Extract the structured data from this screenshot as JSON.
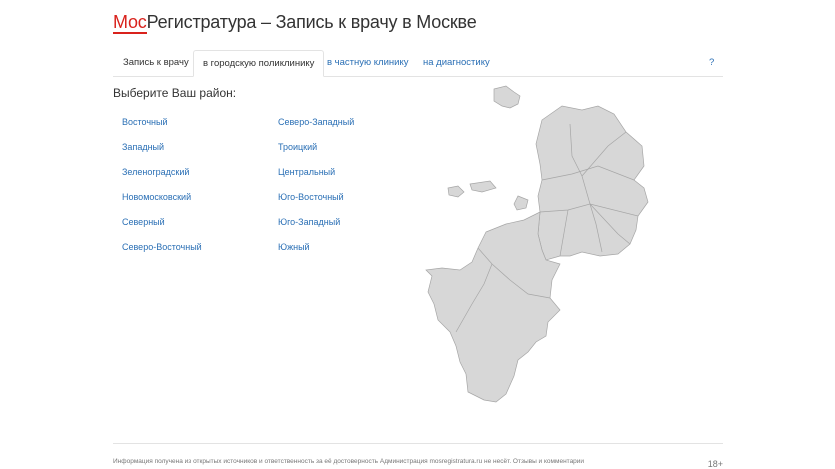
{
  "logo": {
    "part_red": "Мос",
    "part_rest": "Регистратура – Запись к врачу в Москве"
  },
  "tabs": [
    {
      "label": "Запись к врачу"
    },
    {
      "label": "в городскую поликлинику"
    },
    {
      "label": "в частную клинику"
    },
    {
      "label": "на диагностику"
    },
    {
      "label": "?"
    }
  ],
  "heading": "Выберите Ваш район:",
  "districts": {
    "left": [
      "Восточный",
      "Западный",
      "Зеленоградский",
      "Новомосковский",
      "Северный",
      "Северо-Восточный"
    ],
    "right": [
      "Северо-Западный",
      "Троицкий",
      "Центральный",
      "Юго-Восточный",
      "Юго-Западный",
      "Южный"
    ]
  },
  "footer": {
    "text": "Информация получена из открытых источников и ответственность за её достоверность Администрация mosregistratura.ru не несёт. Отзывы и комментарии",
    "age": "18+"
  },
  "colors": {
    "accent": "#d9221c",
    "link": "#2a6fb5",
    "map_fill": "#d7d7d7",
    "map_stroke": "#a6a6a6"
  }
}
